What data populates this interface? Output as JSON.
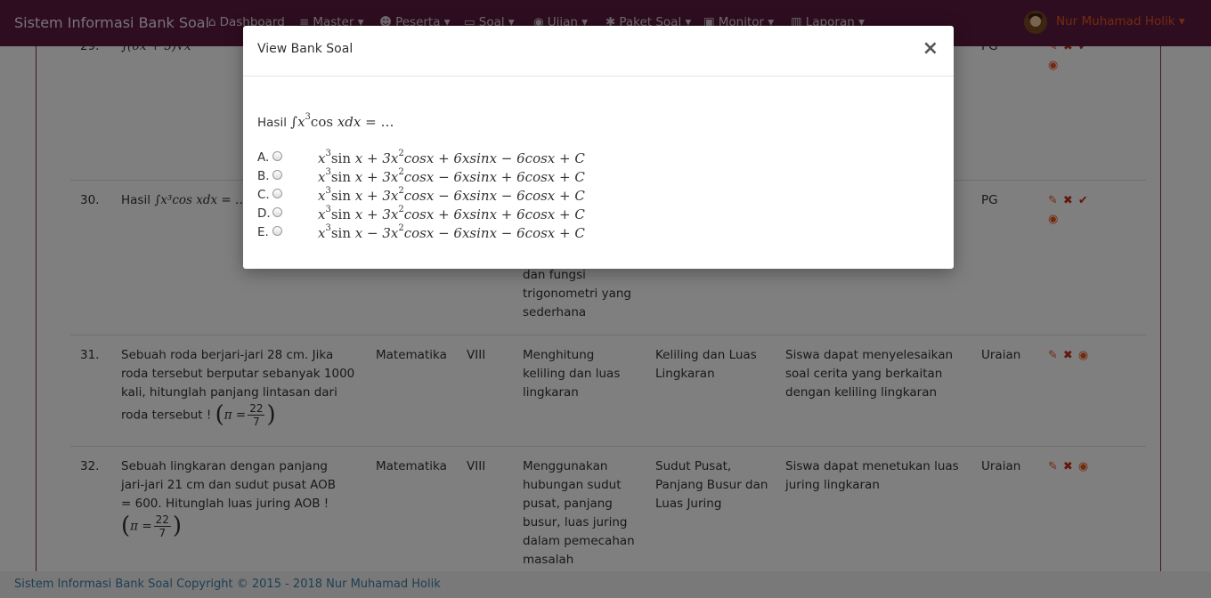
{
  "navbar": {
    "brand": "Sistem Informasi Bank Soal",
    "items": [
      {
        "label": "Dashboard",
        "icon": "home-icon"
      },
      {
        "label": "Master",
        "icon": "database-icon"
      },
      {
        "label": "Peserta",
        "icon": "users-icon"
      },
      {
        "label": "Soal",
        "icon": "monitor-icon"
      },
      {
        "label": "Ujian",
        "icon": "pin-icon"
      },
      {
        "label": "Paket Soal",
        "icon": "gear-icon"
      },
      {
        "label": "Monitor",
        "icon": "tv-icon"
      },
      {
        "label": "Laporan",
        "icon": "bar-chart-icon"
      }
    ],
    "user": "Nur Muhamad Holik"
  },
  "table": {
    "rows": [
      {
        "no": "29.",
        "type": "PG",
        "actions": [
          "edit",
          "delete",
          "check",
          "view"
        ]
      },
      {
        "no": "30.",
        "question_prefix": "Hasil",
        "question_math": "∫x³cos xdx = …",
        "indicator_tail": "dan fungsi trigonometri yang sederhana",
        "type": "PG",
        "actions": [
          "edit",
          "delete",
          "check",
          "view"
        ]
      },
      {
        "no": "31.",
        "question": "Sebuah roda berjari-jari 28 cm. Jika roda tersebut berputar sebanyak 1000 kali, hitunglah panjang lintasan dari roda tersebut !",
        "pi_num": "22",
        "pi_den": "7",
        "subject": "Matematika",
        "class": "VIII",
        "indicator": "Menghitung keliling dan luas lingkaran",
        "material": "Keliling dan Luas Lingkaran",
        "objective": "Siswa dapat menyelesaikan soal cerita yang berkaitan dengan keliling lingkaran",
        "type": "Uraian",
        "actions": [
          "edit",
          "delete",
          "view"
        ]
      },
      {
        "no": "32.",
        "question": "Sebuah lingkaran dengan panjang jari-jari 21 cm dan sudut pusat AOB = 600. Hitunglah luas juring AOB !",
        "pi_num": "22",
        "pi_den": "7",
        "subject": "Matematika",
        "class": "VIII",
        "indicator": "Menggunakan hubungan sudut pusat, panjang busur, luas juring dalam pemecahan masalah",
        "material": "Sudut Pusat, Panjang Busur dan Luas Juring",
        "objective": "Siswa dapat menetukan luas juring lingkaran",
        "type": "Uraian",
        "actions": [
          "edit",
          "delete",
          "view"
        ]
      }
    ]
  },
  "footer": {
    "text": "Sistem Informasi Bank Soal Copyright © 2015 - 2018 Nur Muhamad Holik"
  },
  "modal": {
    "title": "View Bank Soal",
    "close": "×",
    "question_prefix": "Hasil",
    "options": [
      {
        "letter": "A.",
        "signs": [
          "+",
          "+",
          "−"
        ]
      },
      {
        "letter": "B.",
        "signs": [
          "+",
          "−",
          "+"
        ]
      },
      {
        "letter": "C.",
        "signs": [
          "+",
          "−",
          "−"
        ]
      },
      {
        "letter": "D.",
        "signs": [
          "+",
          "+",
          "+"
        ]
      },
      {
        "letter": "E.",
        "signs": [
          "−",
          "−",
          "−"
        ]
      }
    ]
  },
  "colors": {
    "navbar_bg": "#5c1a40",
    "user_name": "#e8541d",
    "action_icons": "#e8541d",
    "footer_link": "#3d7ea8"
  }
}
